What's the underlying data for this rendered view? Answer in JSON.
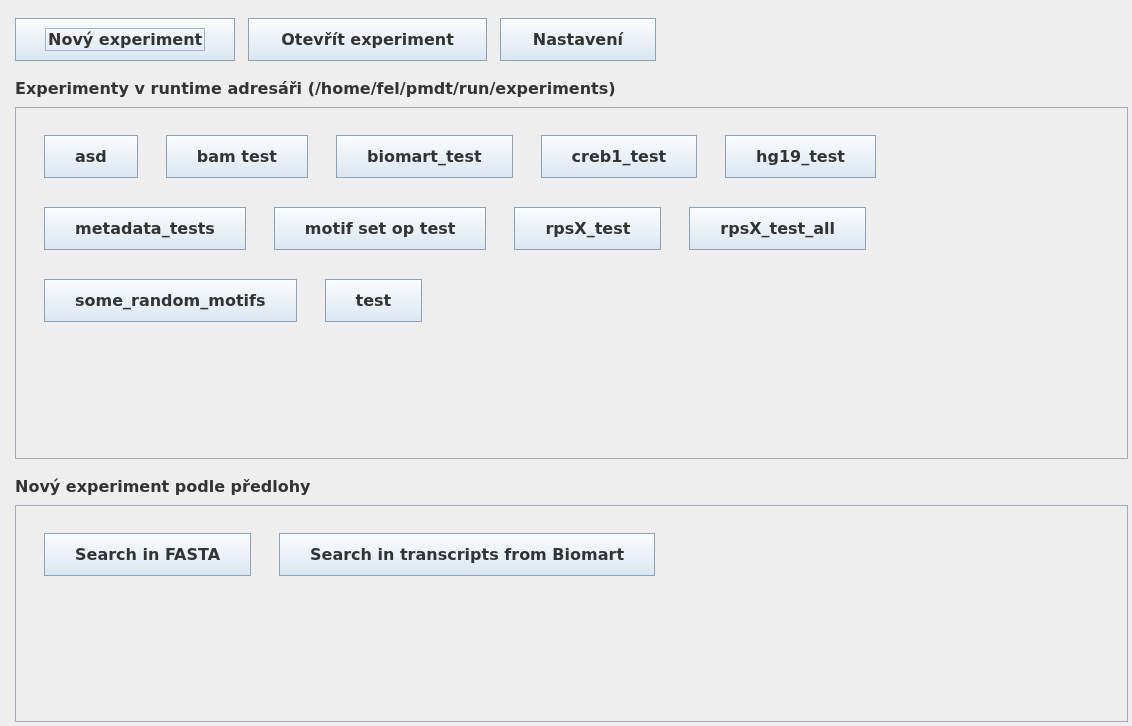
{
  "toolbar": [
    {
      "label": "Nový experiment",
      "focused": true
    },
    {
      "label": "Otevřít experiment",
      "focused": false
    },
    {
      "label": "Nastavení",
      "focused": false
    }
  ],
  "experiments": {
    "heading": "Experimenty v runtime adresáři (/home/fel/pmdt/run/experiments)",
    "buttons": [
      "asd",
      "bam test",
      "biomart_test",
      "creb1_test",
      "hg19_test",
      "metadata_tests",
      "motif set op test",
      "rpsX_test",
      "rpsX_test_all",
      "some_random_motifs",
      "test"
    ]
  },
  "templates": {
    "heading": "Nový experiment podle předlohy",
    "buttons": [
      "Search in FASTA",
      "Search in transcripts from Biomart"
    ]
  }
}
